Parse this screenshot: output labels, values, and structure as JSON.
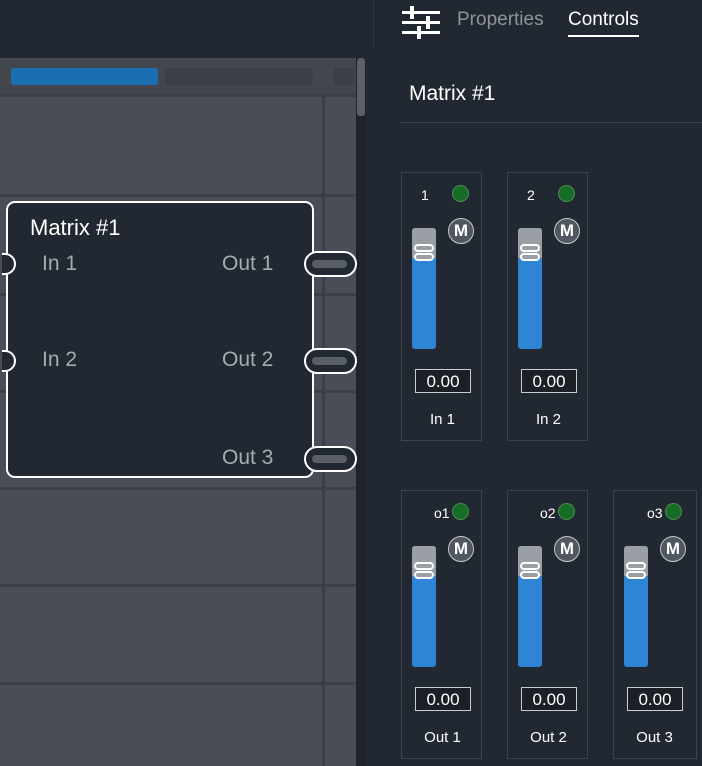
{
  "tabs": {
    "properties": "Properties",
    "controls": "Controls",
    "active": "Controls"
  },
  "canvas": {
    "hscroll_progress": 0.45,
    "node": {
      "title": "Matrix #1",
      "inputs": [
        "In 1",
        "In 2"
      ],
      "outputs": [
        "Out 1",
        "Out 2",
        "Out 3"
      ]
    }
  },
  "panel": {
    "title": "Matrix #1",
    "inputs": [
      {
        "id": "1",
        "mute": "M",
        "value": "0.00",
        "label": "In 1"
      },
      {
        "id": "2",
        "mute": "M",
        "value": "0.00",
        "label": "In 2"
      }
    ],
    "outputs": [
      {
        "id": "o1",
        "mute": "M",
        "value": "0.00",
        "label": "Out 1"
      },
      {
        "id": "o2",
        "mute": "M",
        "value": "0.00",
        "label": "Out 2"
      },
      {
        "id": "o3",
        "mute": "M",
        "value": "0.00",
        "label": "Out 3"
      }
    ]
  },
  "colors": {
    "accent": "#2f84d6",
    "led_on": "#176d25",
    "background": "#222831",
    "canvas": "#4a4d55"
  }
}
